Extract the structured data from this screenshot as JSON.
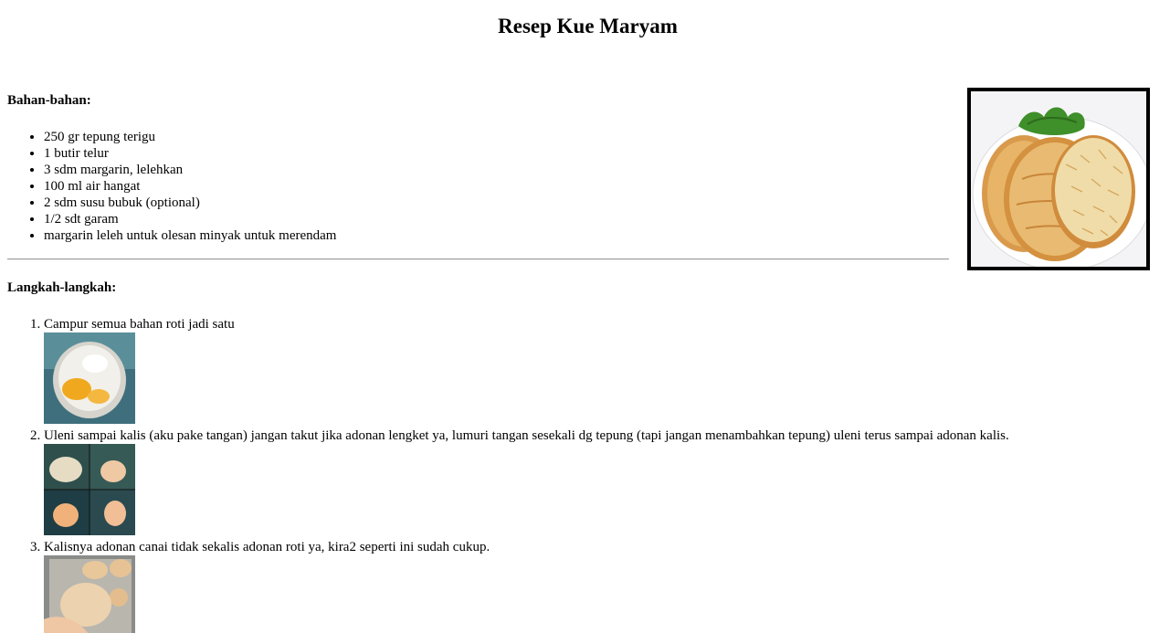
{
  "title": "Resep Kue Maryam",
  "ingredients": {
    "heading": "Bahan-bahan:",
    "items": [
      "250 gr tepung terigu",
      "1 butir telur",
      "3 sdm margarin, lelehkan",
      "100 ml air hangat",
      "2 sdm susu bubuk (optional)",
      "1/2 sdt garam",
      "margarin leleh untuk olesan minyak untuk merendam"
    ]
  },
  "steps": {
    "heading": "Langkah-langkah:",
    "items": [
      "Campur semua bahan roti jadi satu",
      "Uleni sampai kalis (aku pake tangan) jangan takut jika adonan lengket ya, lumuri tangan sesekali dg tepung (tapi jangan menambahkan tepung) uleni terus sampai adonan kalis.",
      "Kalisnya adonan canai tidak sekalis adonan roti ya, kira2 seperti ini sudah cukup."
    ]
  }
}
